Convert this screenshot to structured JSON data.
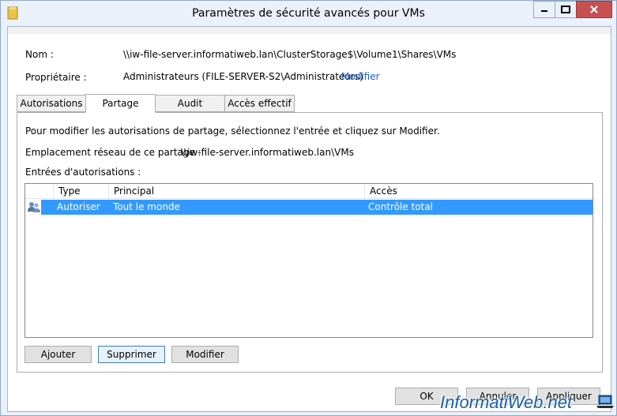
{
  "window": {
    "title": "Paramètres de sécurité avancés pour VMs"
  },
  "header": {
    "name_label": "Nom :",
    "name_value": "\\\\iw-file-server.informatiweb.lan\\ClusterStorage$\\Volume1\\Shares\\VMs",
    "owner_label": "Propriétaire :",
    "owner_value": "Administrateurs (FILE-SERVER-S2\\Administrateurs)",
    "owner_change_link": "Modifier"
  },
  "tabs": [
    {
      "label": "Autorisations",
      "active": false
    },
    {
      "label": "Partage",
      "active": true
    },
    {
      "label": "Audit",
      "active": false
    },
    {
      "label": "Accès effectif",
      "active": false
    }
  ],
  "content": {
    "instruction": "Pour modifier les autorisations de partage, sélectionnez l'entrée et cliquez sur Modifier.",
    "network_location_label": "Emplacement réseau de ce partage :",
    "network_location_value": "\\\\iw-file-server.informatiweb.lan\\VMs",
    "entries_label": "Entrées d'autorisations :"
  },
  "table": {
    "columns": [
      "Type",
      "Principal",
      "Accès"
    ],
    "rows": [
      {
        "type": "Autoriser",
        "principal": "Tout le monde",
        "access": "Contrôle total",
        "icon": "users-icon",
        "selected": true
      }
    ]
  },
  "actions": {
    "add": "Ajouter",
    "remove": "Supprimer",
    "edit": "Modifier"
  },
  "footer": {
    "ok": "OK",
    "cancel": "Annuler",
    "apply": "Appliquer"
  },
  "watermark": "InformatiWeb.net",
  "colors": {
    "selection": "#3399ff",
    "link": "#1f5fc9",
    "close_button": "#c75050"
  }
}
